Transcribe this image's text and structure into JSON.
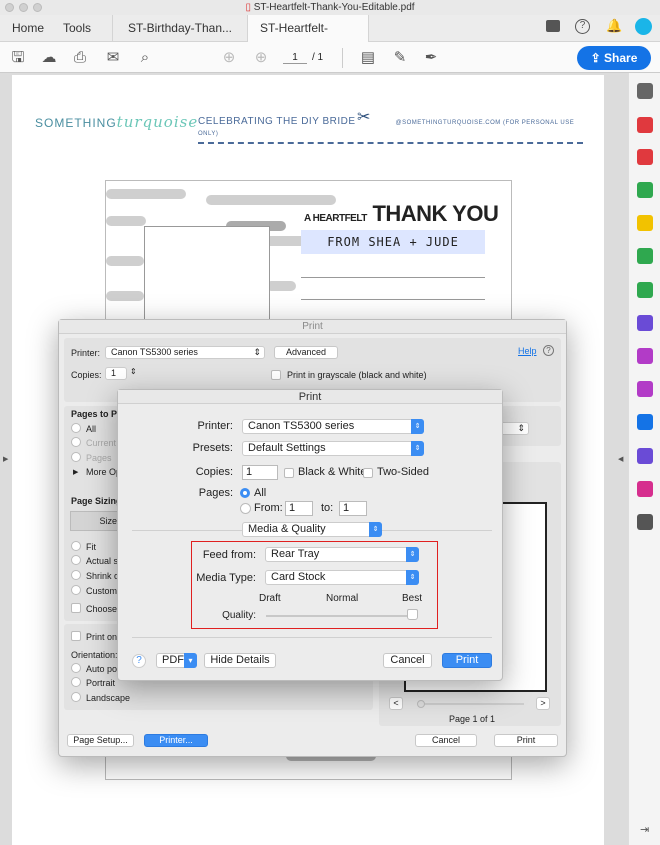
{
  "window": {
    "title": "ST-Heartfelt-Thank-You-Editable.pdf"
  },
  "tabs": {
    "home": "Home",
    "tools": "Tools",
    "docs": [
      {
        "label": "ST-Birthday-Than..."
      },
      {
        "label": "ST-Heartfelt-Than...",
        "active": true
      }
    ],
    "close": "×"
  },
  "toolbar": {
    "page_current": "1",
    "page_total": "/ 1",
    "share": "Share",
    "icons": [
      "save-icon",
      "upload-icon",
      "print-icon",
      "email-icon",
      "zoom-search-icon",
      "prev-page-icon",
      "next-page-icon",
      "comment-icon",
      "pen-icon",
      "sign-icon"
    ]
  },
  "header_icons": [
    "chat-icon",
    "help-icon",
    "notification-bell-icon",
    "avatar"
  ],
  "accent": "#1473e6",
  "document": {
    "brand_a": "SOMETHING",
    "brand_b": "turquoise",
    "tagline": "CELEBRATING THE DIY BRIDE",
    "site": "@SOMETHINGTURQUOISE.COM  (FOR PERSONAL USE ONLY)",
    "heading_small": "A HEARTFELT",
    "heading_big": "THANK YOU",
    "from": "FROM SHEA + JUDE"
  },
  "sidebar_icons": [
    {
      "name": "zoom-icon",
      "color": "#666"
    },
    {
      "name": "export-pdf-icon",
      "color": "#e0393e"
    },
    {
      "name": "organize-pages-icon",
      "color": "#e0393e"
    },
    {
      "name": "edit-pdf-icon",
      "color": "#2fa84f"
    },
    {
      "name": "comment-tool-icon",
      "color": "#f2c200"
    },
    {
      "name": "combine-files-icon",
      "color": "#2fa84f"
    },
    {
      "name": "print-production-icon",
      "color": "#2fa84f"
    },
    {
      "name": "protect-icon",
      "color": "#6a4bd6"
    },
    {
      "name": "fill-sign-icon",
      "color": "#b23bc7"
    },
    {
      "name": "create-pdf-icon",
      "color": "#b23bc7"
    },
    {
      "name": "share-icon",
      "color": "#1473e6"
    },
    {
      "name": "send-for-signature-icon",
      "color": "#6a4bd6"
    },
    {
      "name": "stamp-icon",
      "color": "#d62e8e"
    },
    {
      "name": "more-tools-icon",
      "color": "#555"
    }
  ],
  "back_dialog": {
    "title": "Print",
    "printer_label": "Printer:",
    "printer": "Canon TS5300 series",
    "advanced": "Advanced",
    "help": "Help",
    "copies_label": "Copies:",
    "copies": "1",
    "grayscale": "Print in grayscale (black and white)",
    "pages_title": "Pages to Pr",
    "pages_all": "All",
    "pages_current": "Current",
    "pages_pages": "Pages",
    "more_options": "More Op",
    "sizing_title": "Page Sizing",
    "size_btn": "Size",
    "fit": "Fit",
    "actual": "Actual si",
    "shrink": "Shrink o",
    "custom": "Custom",
    "choose": "Choose",
    "print_on": "Print on",
    "orientation": "Orientation:",
    "auto": "Auto por",
    "portrait": "Portrait",
    "landscape": "Landscape",
    "prev": "<",
    "next": ">",
    "page_of": "Page 1 of 1",
    "page_setup": "Page Setup...",
    "printer_btn": "Printer...",
    "cancel": "Cancel",
    "print": "Print"
  },
  "front_dialog": {
    "title": "Print",
    "printer_label": "Printer:",
    "printer": "Canon TS5300 series",
    "presets_label": "Presets:",
    "presets": "Default Settings",
    "copies_label": "Copies:",
    "copies": "1",
    "bw": "Black & White",
    "two_sided": "Two-Sided",
    "pages_label": "Pages:",
    "all": "All",
    "from_label": "From:",
    "from": "1",
    "to_label": "to:",
    "to": "1",
    "section": "Media & Quality",
    "feed_label": "Feed from:",
    "feed": "Rear Tray",
    "media_label": "Media Type:",
    "media": "Card Stock",
    "quality_label": "Quality:",
    "quality_ticks": [
      "Draft",
      "Normal",
      "Best"
    ],
    "quality_value": "Best",
    "help": "?",
    "pdf": "PDF",
    "hide_details": "Hide Details",
    "cancel": "Cancel",
    "print": "Print",
    "highlight_color": "#e02020"
  }
}
